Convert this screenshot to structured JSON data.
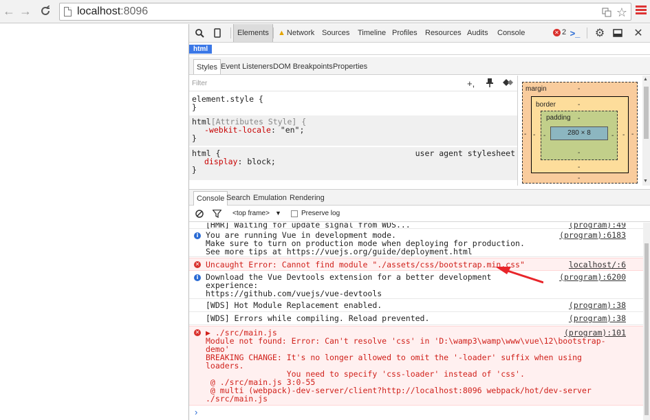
{
  "browser": {
    "url_host": "localhost",
    "url_port": ":8096",
    "back_glyph": "←",
    "forward_glyph": "→",
    "reload_glyph": "C"
  },
  "devtools": {
    "tabs": [
      "Elements",
      "Network",
      "Sources",
      "Timeline",
      "Profiles",
      "Resources",
      "Audits",
      "Console"
    ],
    "active_tab": "Elements",
    "error_count": "2",
    "breadcrumb": "html",
    "style_tabs": [
      "Styles",
      "Event Listeners",
      "DOM Breakpoints",
      "Properties"
    ],
    "filter_placeholder": "Filter"
  },
  "styles": {
    "r1_line1": "element.style {",
    "r1_line2": "}",
    "r2_sel": "html",
    "r2_sel_attr": "[Attributes Style] {",
    "r2_prop": "-webkit-locale",
    "r2_val": ": \"en\";",
    "r2_close": "}",
    "r3_sel": "html {",
    "r3_origin": "user agent stylesheet",
    "r3_prop": "display",
    "r3_val": ": block;",
    "r3_close": "}"
  },
  "box_model": {
    "margin_label": "margin",
    "border_label": "border",
    "padding_label": "padding",
    "content_size": "280 × 8",
    "dash": "-"
  },
  "drawer": {
    "tabs": [
      "Console",
      "Search",
      "Emulation",
      "Rendering"
    ],
    "active_tab": "Console",
    "frame": "<top frame>",
    "preserve_log": "Preserve log"
  },
  "console": {
    "messages": [
      {
        "type": "log",
        "text": "[HMR] Waiting for update signal from WDS...",
        "source": "(program):49"
      },
      {
        "type": "info",
        "text": "You are running Vue in development mode.\nMake sure to turn on production mode when deploying for production.\nSee more tips at https://vuejs.org/guide/deployment.html",
        "source": "(program):6183"
      },
      {
        "type": "error",
        "text": "Uncaught Error: Cannot find module \"./assets/css/bootstrap.min.css\"",
        "source": "localhost/:6"
      },
      {
        "type": "info",
        "text": "Download the Vue Devtools extension for a better development\nexperience:\nhttps://github.com/vuejs/vue-devtools",
        "source": "(program):6200"
      },
      {
        "type": "log",
        "text": "[WDS] Hot Module Replacement enabled.",
        "source": "(program):38"
      },
      {
        "type": "log",
        "text": "[WDS] Errors while compiling. Reload prevented.",
        "source": "(program):38"
      },
      {
        "type": "error",
        "text": "▶ ./src/main.js\nModule not found: Error: Can't resolve 'css' in 'D:\\wamp3\\wamp\\www\\vue\\12\\bootstrap-\ndemo'\nBREAKING CHANGE: It's no longer allowed to omit the '-loader' suffix when using\nloaders.\n                 You need to specify 'css-loader' instead of 'css'.\n @ ./src/main.js 3:0-55\n @ multi (webpack)-dev-server/client?http://localhost:8096 webpack/hot/dev-server\n./src/main.js",
        "source": "(program):101"
      }
    ],
    "prompt": "›"
  },
  "colors": {
    "error_text": "#d0201a",
    "error_bg": "#fff0f0",
    "info_icon": "#2a6bd4",
    "accent_blue": "#3b78e7",
    "arrow_red": "#e8252a"
  }
}
